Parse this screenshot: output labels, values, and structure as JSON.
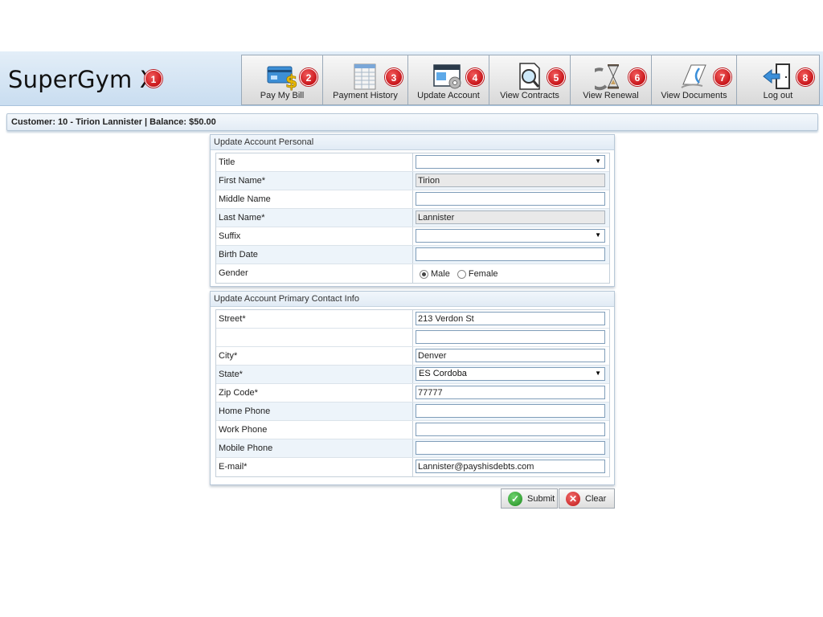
{
  "app": {
    "title": "SuperGym X",
    "title_badge": "1"
  },
  "toolbar": [
    {
      "label": "Pay My Bill",
      "badge": "2",
      "icon": "credit-card-dollar-icon"
    },
    {
      "label": "Payment History",
      "badge": "3",
      "icon": "ledger-spreadsheet-icon"
    },
    {
      "label": "Update Account",
      "badge": "4",
      "icon": "window-gear-icon"
    },
    {
      "label": "View Contracts",
      "badge": "5",
      "icon": "document-magnifier-icon"
    },
    {
      "label": "View Renewal",
      "badge": "6",
      "icon": "hourglass-refresh-icon"
    },
    {
      "label": "View Documents",
      "badge": "7",
      "icon": "document-curl-icon"
    },
    {
      "label": "Log out",
      "badge": "8",
      "icon": "door-exit-arrow-icon"
    }
  ],
  "customer_bar": {
    "text": "Customer: 10 - Tirion Lannister | Balance: $50.00"
  },
  "personal": {
    "title": "Update Account Personal",
    "fields": {
      "title_label": "Title",
      "title_value": "",
      "first_label": "First Name*",
      "first_value": "Tirion",
      "middle_label": "Middle Name",
      "middle_value": "",
      "last_label": "Last Name*",
      "last_value": "Lannister",
      "suffix_label": "Suffix",
      "suffix_value": "",
      "birth_label": "Birth Date",
      "birth_value": "",
      "gender_label": "Gender",
      "gender_male": "Male",
      "gender_female": "Female"
    }
  },
  "contact": {
    "title": "Update Account Primary Contact Info",
    "fields": {
      "street_label": "Street*",
      "street_value": "213 Verdon St",
      "street2_value": "",
      "city_label": "City*",
      "city_value": "Denver",
      "state_label": "State*",
      "state_value": "ES Cordoba",
      "zip_label": "Zip Code*",
      "zip_value": "77777",
      "home_label": "Home Phone",
      "home_value": "",
      "work_label": "Work Phone",
      "work_value": "",
      "mobile_label": "Mobile Phone",
      "mobile_value": "",
      "email_label": "E-mail*",
      "email_value": "Lannister@payshisdebts.com"
    }
  },
  "buttons": {
    "submit": "Submit",
    "clear": "Clear"
  },
  "colors": {
    "badge": "#c8161b",
    "header_bg": "#d6e6f5",
    "submit": "#1e8a1e",
    "clear": "#c01818"
  }
}
